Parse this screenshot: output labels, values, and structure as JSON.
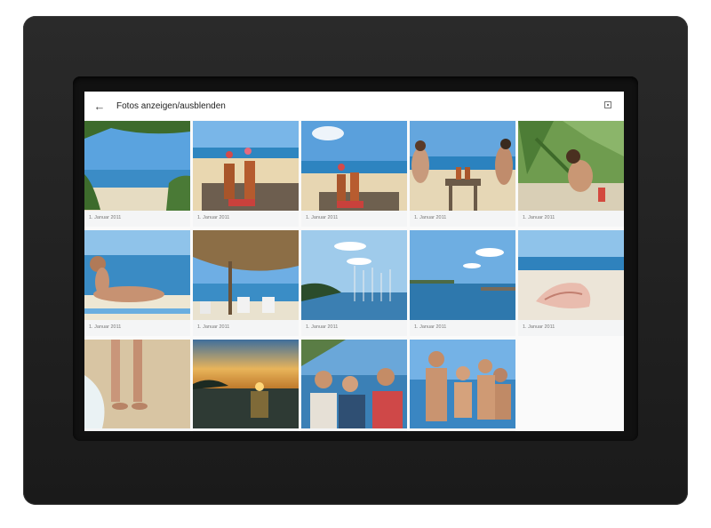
{
  "toolbar": {
    "title": "Fotos anzeigen/ausblenden",
    "back_icon": "arrow-left-icon",
    "menu_icon": "square-dot-icon"
  },
  "photos": [
    {
      "id": 1,
      "date": "1. Januar 2011",
      "scene": "beach-palm"
    },
    {
      "id": 2,
      "date": "1. Januar 2011",
      "scene": "cocktails-table"
    },
    {
      "id": 3,
      "date": "1. Januar 2011",
      "scene": "cocktails-beach"
    },
    {
      "id": 4,
      "date": "1. Januar 2011",
      "scene": "couple-table"
    },
    {
      "id": 5,
      "date": "1. Januar 2011",
      "scene": "woman-palms"
    },
    {
      "id": 6,
      "date": "1. Januar 2011",
      "scene": "woman-lying"
    },
    {
      "id": 7,
      "date": "1. Januar 2011",
      "scene": "beach-umbrella"
    },
    {
      "id": 8,
      "date": "1. Januar 2011",
      "scene": "harbor-boats"
    },
    {
      "id": 9,
      "date": "1. Januar 2011",
      "scene": "sea-pier"
    },
    {
      "id": 10,
      "date": "1. Januar 2011",
      "scene": "seashell"
    },
    {
      "id": 11,
      "date": "",
      "scene": "feet-beach"
    },
    {
      "id": 12,
      "date": "",
      "scene": "sunset"
    },
    {
      "id": 13,
      "date": "",
      "scene": "friends-group"
    },
    {
      "id": 14,
      "date": "",
      "scene": "friends-beach"
    }
  ],
  "colors": {
    "sky": "#5d9fd8",
    "sea": "#2f7fb5",
    "sand": "#e3d2ac",
    "wood": "#6b5a48"
  }
}
